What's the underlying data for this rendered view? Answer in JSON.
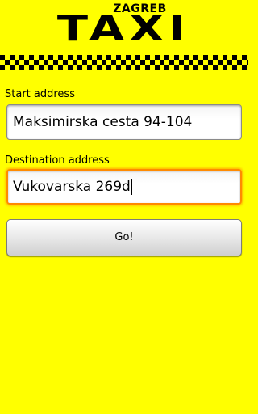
{
  "app": {
    "city": "ZAGREB",
    "brand": "TAXI"
  },
  "colors": {
    "background": "#ffff00",
    "focus_border": "#ff8a00"
  },
  "form": {
    "start_label": "Start address",
    "start_value": "Maksimirska cesta 94-104",
    "destination_label": "Destination address",
    "destination_value": "Vukovarska 269d",
    "go_label": "Go!"
  }
}
